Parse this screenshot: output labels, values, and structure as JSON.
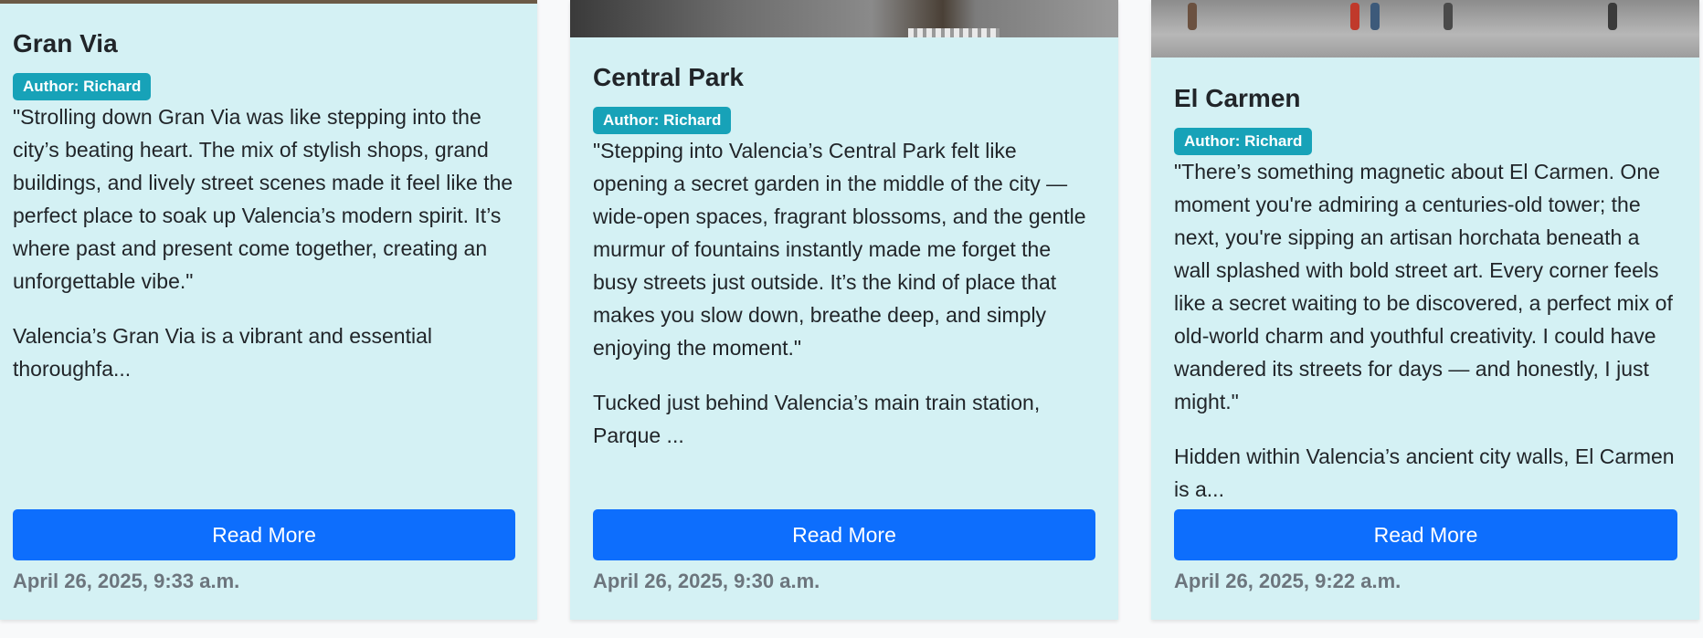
{
  "cards": [
    {
      "title": "Gran Via",
      "author": "Author: Richard",
      "quote": "\"Strolling down Gran Via was like stepping into the city’s beating heart. The mix of stylish shops, grand buildings, and lively street scenes made it feel like the perfect place to soak up Valencia’s modern spirit. It’s where past and present come together, creating an unforgettable vibe.\"",
      "excerpt": "Valencia’s Gran Via is a vibrant and essential thoroughfa...",
      "button": "Read More",
      "date": "April 26, 2025, 9:33 a.m."
    },
    {
      "title": "Central Park",
      "author": "Author: Richard",
      "quote": "\"Stepping into Valencia’s Central Park felt like opening a secret garden in the middle of the city — wide-open spaces, fragrant blossoms, and the gentle murmur of fountains instantly made me forget the busy streets just outside. It’s the kind of place that makes you slow down, breathe deep, and simply enjoying the moment.\"",
      "excerpt": "Tucked just behind Valencia’s main train station, Parque ...",
      "button": "Read More",
      "date": "April 26, 2025, 9:30 a.m."
    },
    {
      "title": "El Carmen",
      "author": "Author: Richard",
      "quote": "\"There’s something magnetic about El Carmen. One moment you're admiring a centuries-old tower; the next, you're sipping an artisan horchata beneath a wall splashed with bold street art. Every corner feels like a secret waiting to be discovered, a perfect mix of old-world charm and youthful creativity. I could have wandered its streets for days — and honestly, I just might.\"",
      "excerpt": "Hidden within Valencia’s ancient city walls, El Carmen is a...",
      "button": "Read More",
      "date": "April 26, 2025, 9:22 a.m."
    }
  ],
  "colors": {
    "card_background": "#d4f1f4",
    "badge": "#17a2b8",
    "button": "#0d6efd",
    "date_text": "#6c757d"
  }
}
